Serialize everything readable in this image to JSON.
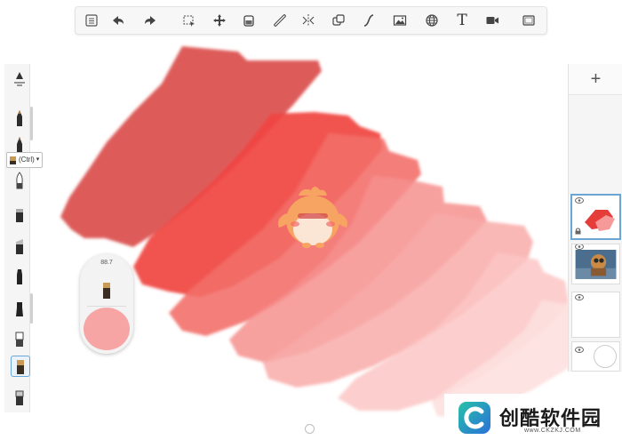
{
  "toolbar": {
    "items": [
      "list-menu-icon",
      "undo-icon",
      "redo-icon",
      "selection-icon",
      "move-icon",
      "fill-bucket-icon",
      "ruler-icon",
      "symmetry-icon",
      "layers-copy-icon",
      "curve-icon",
      "image-import-icon",
      "perspective-grid-icon",
      "text-icon",
      "video-record-icon",
      "fullscreen-icon"
    ],
    "text_tool_label": "T"
  },
  "brushes": {
    "shortcut_tip": "(Ctrl)"
  },
  "puck": {
    "brush_size": "88.7",
    "color": "#f6a4a4"
  },
  "layers": {
    "add_label": "+"
  },
  "watermark": {
    "title": "创酷软件园",
    "url": "www.CKZKJ.COM"
  },
  "colors": {
    "accent": "#6aa6d6",
    "stroke_dark": "#d9403f",
    "stroke_red": "#f04a46",
    "stroke_mid": "#f37472",
    "stroke_light": "#f9b6b3",
    "stroke_pale": "#fcd6d4"
  }
}
